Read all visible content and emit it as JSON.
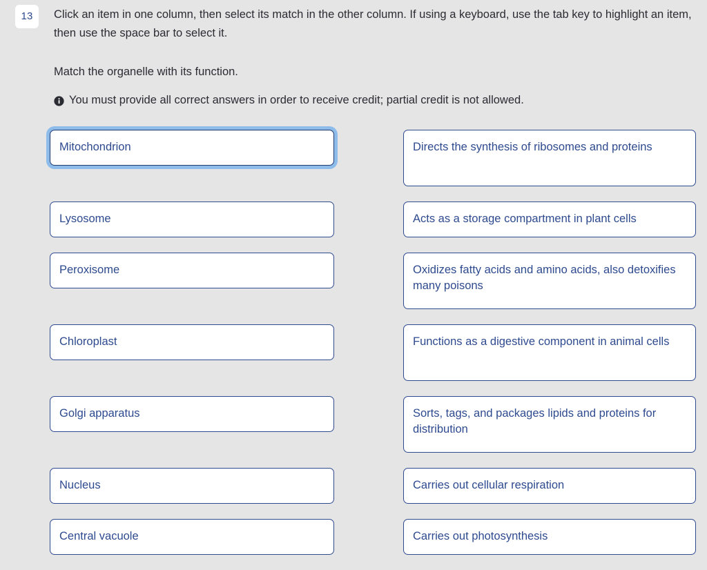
{
  "question": {
    "number": "13",
    "instructions": "Click an item in one column, then select its match in the other column. If using a keyboard, use the tab key to highlight an item, then use the space bar to select it.",
    "prompt": "Match the organelle with its function.",
    "credit_note": "You must provide all correct answers in order to receive credit; partial credit is not allowed.",
    "info_icon": "info-circle-icon"
  },
  "colors": {
    "page_background": "#e5e5e5",
    "option_border": "#2e4a8f",
    "option_text": "#2e4a8f",
    "option_background": "#ffffff",
    "focus_ring": "#8dbcea",
    "body_text": "#2b2b33",
    "badge_background": "#ffffff",
    "badge_text": "#2e4a8f"
  },
  "rows": [
    {
      "left": {
        "label": "Mitochondrion",
        "focused": true,
        "tall": false
      },
      "right": {
        "label": "Directs the synthesis of ribosomes and proteins",
        "focused": false,
        "tall": true
      }
    },
    {
      "left": {
        "label": "Lysosome",
        "focused": false,
        "tall": false
      },
      "right": {
        "label": "Acts as a storage compartment in plant cells",
        "focused": false,
        "tall": false
      }
    },
    {
      "left": {
        "label": "Peroxisome",
        "focused": false,
        "tall": false
      },
      "right": {
        "label": "Oxidizes fatty acids and amino acids, also detoxifies many poisons",
        "focused": false,
        "tall": true
      }
    },
    {
      "left": {
        "label": "Chloroplast",
        "focused": false,
        "tall": false
      },
      "right": {
        "label": "Functions as a digestive component in animal cells",
        "focused": false,
        "tall": true
      }
    },
    {
      "left": {
        "label": "Golgi apparatus",
        "focused": false,
        "tall": false
      },
      "right": {
        "label": "Sorts, tags, and packages lipids and proteins for distribution",
        "focused": false,
        "tall": true
      }
    },
    {
      "left": {
        "label": "Nucleus",
        "focused": false,
        "tall": false
      },
      "right": {
        "label": "Carries out cellular respiration",
        "focused": false,
        "tall": false
      }
    },
    {
      "left": {
        "label": "Central vacuole",
        "focused": false,
        "tall": false
      },
      "right": {
        "label": "Carries out photosynthesis",
        "focused": false,
        "tall": false
      }
    }
  ]
}
